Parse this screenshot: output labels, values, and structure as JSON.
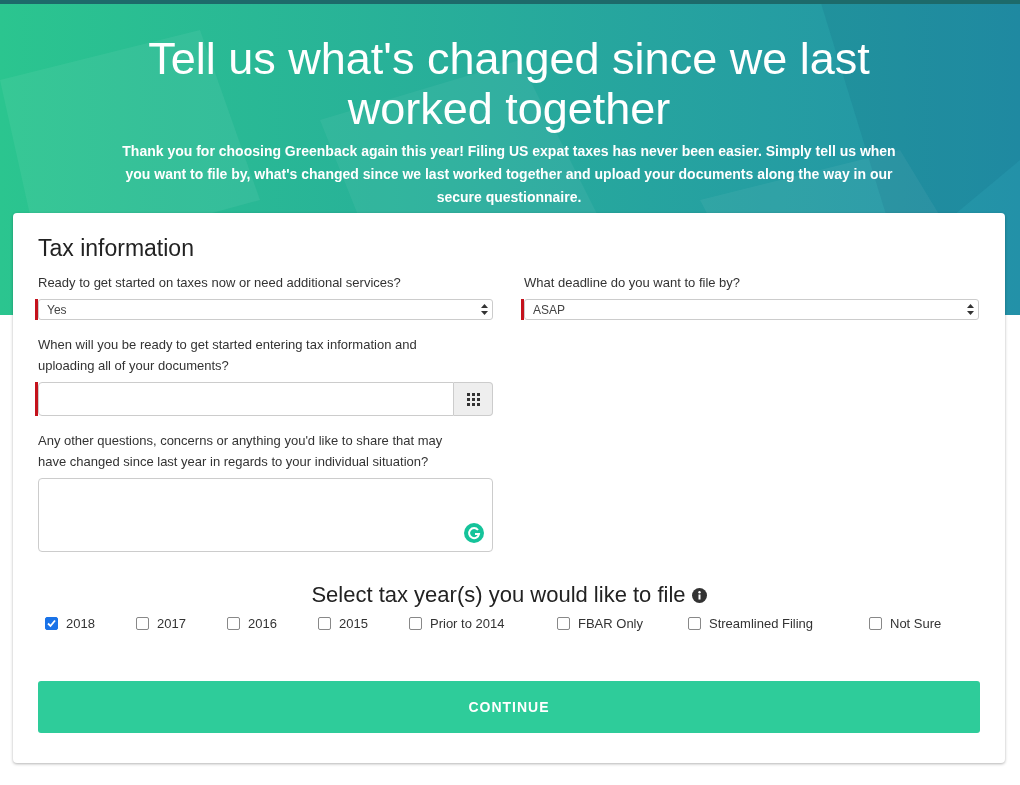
{
  "hero": {
    "title": "Tell us what's changed since we last worked together",
    "intro": "Thank you for choosing Greenback again this year! Filing US expat taxes has never been easier. Simply tell us when you want to file by, what's changed since we last worked together and upload your documents along the way in our secure questionnaire."
  },
  "form": {
    "title": "Tax information",
    "fields": [
      {
        "kind": "select",
        "label": "Ready to get started on taxes now or need additional services?",
        "value": "Yes",
        "required": true
      },
      {
        "kind": "select",
        "label": "What deadline do you want to file by?",
        "value": "ASAP",
        "required": true
      },
      {
        "kind": "date",
        "label": "When will you be ready to get started entering tax information and uploading all of your documents?",
        "required": true
      },
      {
        "kind": "textarea",
        "label": "Any other questions, concerns or anything you'd like to share that may have changed since last year in regards to your individual situation?",
        "required": false
      }
    ],
    "years_title": "Select tax year(s) you would like to file",
    "years": [
      {
        "label": "2018",
        "checked": true
      },
      {
        "label": "2017",
        "checked": false
      },
      {
        "label": "2016",
        "checked": false
      },
      {
        "label": "2015",
        "checked": false
      },
      {
        "label": "Prior to 2014",
        "checked": false
      },
      {
        "label": "FBAR Only",
        "checked": false
      },
      {
        "label": "Streamlined Filing",
        "checked": false
      },
      {
        "label": "Not Sure",
        "checked": false
      }
    ],
    "submit": "CONTINUE"
  }
}
